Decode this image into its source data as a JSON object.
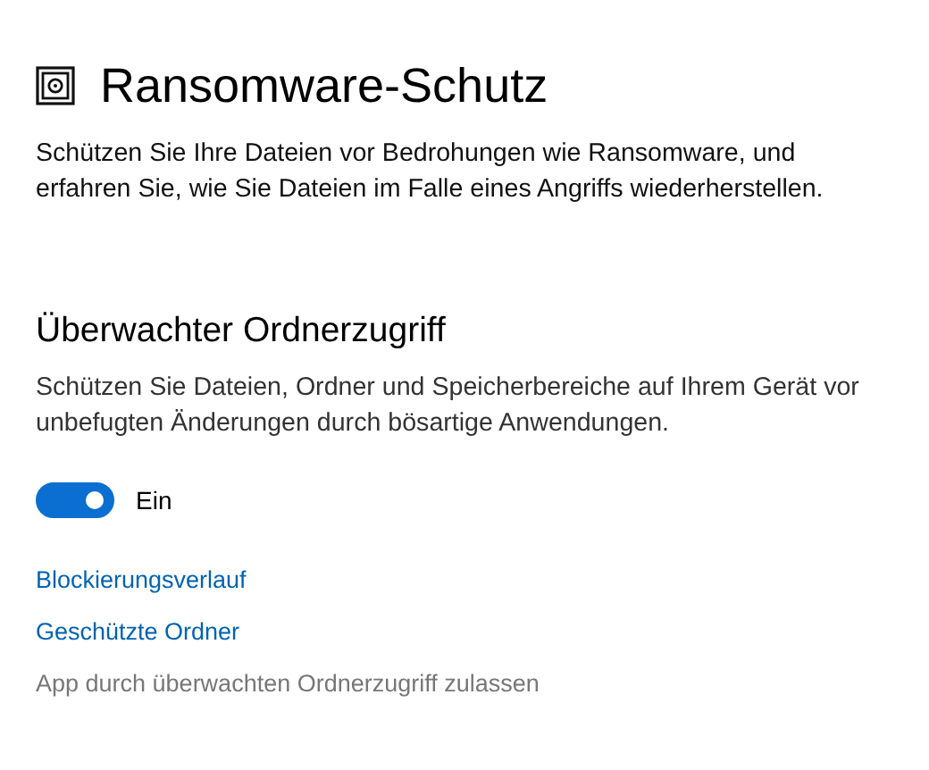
{
  "page": {
    "title": "Ransomware-Schutz",
    "description": "Schützen Sie Ihre Dateien vor Bedrohungen wie Ransomware, und erfahren Sie, wie Sie Dateien im Falle eines Angriffs wiederherstellen."
  },
  "section": {
    "title": "Überwachter Ordnerzugriff",
    "description": "Schützen Sie Dateien, Ordner und Speicherbereiche auf Ihrem Gerät vor unbefugten Änderungen durch bösartige Anwendungen."
  },
  "toggle": {
    "on": true,
    "label": "Ein"
  },
  "links": [
    {
      "label": "Blockierungsverlauf",
      "disabled": false
    },
    {
      "label": "Geschützte Ordner",
      "disabled": false
    },
    {
      "label": "App durch überwachten Ordnerzugriff zulassen",
      "disabled": true
    }
  ]
}
